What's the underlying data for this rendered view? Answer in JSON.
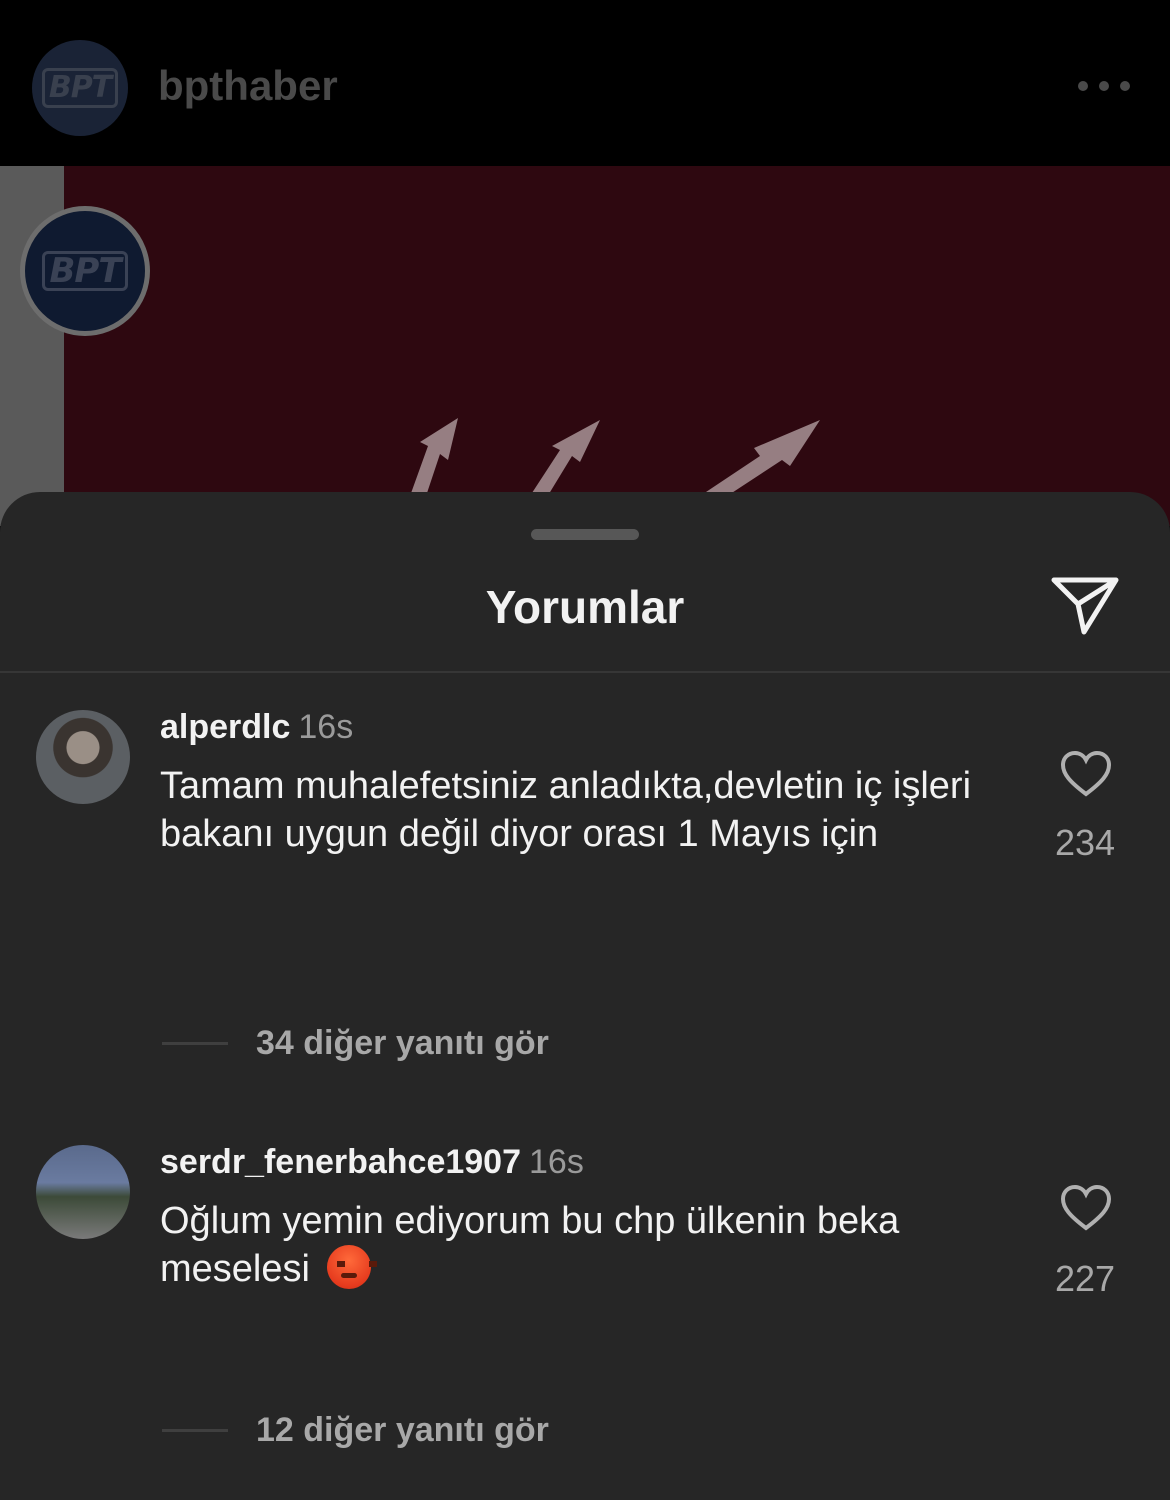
{
  "header": {
    "username": "bpthaber",
    "logo_text": "BPT"
  },
  "post": {
    "logo_text": "BPT"
  },
  "sheet": {
    "title": "Yorumlar"
  },
  "comments": [
    {
      "username": "alperdlc",
      "time": "16s",
      "text": "Tamam muhalefetsiniz anladıkta,devletin iç işleri bakanı uygun değil diyor orası 1 Mayıs için",
      "likes": "234",
      "replies": "34 diğer yanıtı gör"
    },
    {
      "username": "serdr_fenerbahce1907",
      "time": "16s",
      "text": "Oğlum yemin ediyorum bu chp ülkenin beka meselesi",
      "emoji": "angry-face",
      "likes": "227",
      "replies": "12 diğer yanıtı gör"
    }
  ],
  "icons": {
    "more": "more-horizontal-icon",
    "share": "paper-plane-icon",
    "like": "heart-icon"
  }
}
